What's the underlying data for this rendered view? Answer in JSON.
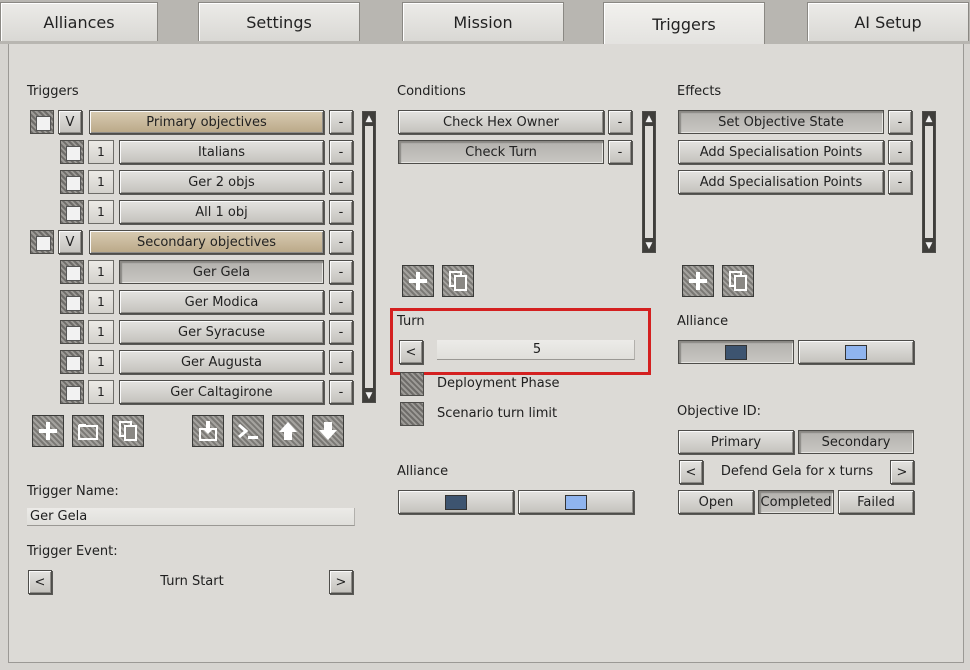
{
  "tabs": [
    "Alliances",
    "Settings",
    "Mission",
    "Triggers",
    "AI Setup"
  ],
  "active_tab": "Triggers",
  "triggers": {
    "heading": "Triggers",
    "rows": [
      {
        "type": "group",
        "num": "V",
        "label": "Primary objectives",
        "remove": "-"
      },
      {
        "type": "item",
        "num": "1",
        "label": "Italians",
        "remove": "-"
      },
      {
        "type": "item",
        "num": "1",
        "label": "Ger 2 objs",
        "remove": "-"
      },
      {
        "type": "item",
        "num": "1",
        "label": "All 1 obj",
        "remove": "-"
      },
      {
        "type": "group",
        "num": "V",
        "label": "Secondary objectives",
        "remove": "-"
      },
      {
        "type": "item",
        "num": "1",
        "label": "Ger Gela",
        "remove": "-",
        "selected": true
      },
      {
        "type": "item",
        "num": "1",
        "label": "Ger Modica",
        "remove": "-"
      },
      {
        "type": "item",
        "num": "1",
        "label": "Ger Syracuse",
        "remove": "-"
      },
      {
        "type": "item",
        "num": "1",
        "label": "Ger Augusta",
        "remove": "-"
      },
      {
        "type": "item",
        "num": "1",
        "label": "Ger Caltagirone",
        "remove": "-"
      }
    ],
    "name_label": "Trigger Name:",
    "name_value": "Ger Gela",
    "event_label": "Trigger Event:",
    "event_value": "Turn Start",
    "prev": "<",
    "next": ">"
  },
  "conditions": {
    "heading": "Conditions",
    "items": [
      {
        "label": "Check Hex Owner",
        "remove": "-"
      },
      {
        "label": "Check Turn",
        "remove": "-",
        "selected": true
      }
    ],
    "turn": {
      "label": "Turn",
      "prev": "<",
      "value": "5"
    },
    "deployment_phase": "Deployment Phase",
    "scenario_turn_limit": "Scenario turn limit",
    "alliance_label": "Alliance"
  },
  "effects": {
    "heading": "Effects",
    "items": [
      {
        "label": "Set Objective State",
        "remove": "-",
        "selected": true
      },
      {
        "label": "Add Specialisation Points",
        "remove": "-"
      },
      {
        "label": "Add Specialisation Points",
        "remove": "-"
      }
    ],
    "alliance_label": "Alliance",
    "objective_id_label": "Objective ID:",
    "primary": "Primary",
    "secondary": "Secondary",
    "objective_prev": "<",
    "objective_value": "Defend Gela for x turns",
    "objective_next": ">",
    "open": "Open",
    "completed": "Completed",
    "failed": "Failed"
  },
  "colors": {
    "alliance_dark": "#3d5470",
    "alliance_light": "#8fb4ee",
    "highlight": "#d42020"
  }
}
